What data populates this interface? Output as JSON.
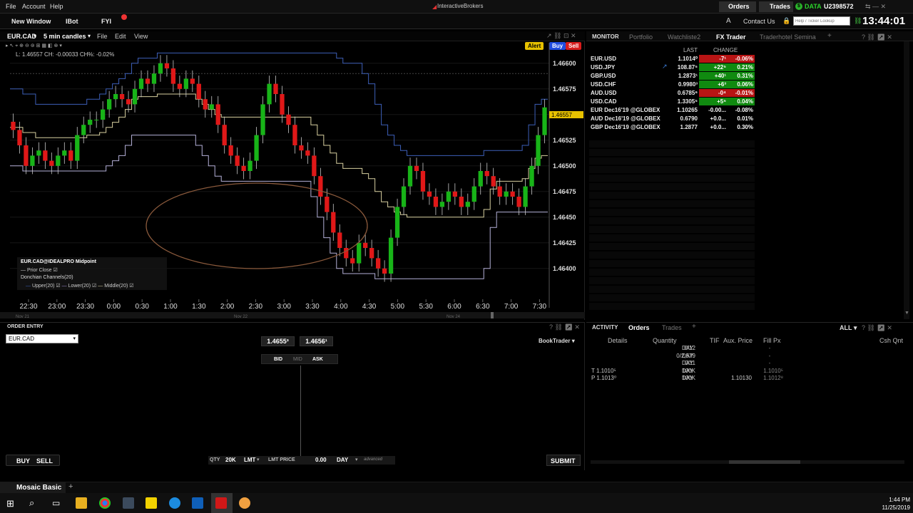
{
  "menubar": {
    "items": [
      "File",
      "Account",
      "Help"
    ],
    "brand": "InteractiveBrokers",
    "orders": "Orders",
    "trades": "Trades",
    "data_label": "DATA",
    "account_id": "U2398572"
  },
  "toolbar": {
    "buttons": [
      "New Window",
      "IBot",
      "FYI"
    ],
    "contact_us": "Contact Us",
    "search_placeholder": "Help / Ticker Lookup",
    "clock": "13:44:01"
  },
  "chart": {
    "symbol": "EUR.CAD",
    "timeframe": "5 min candles",
    "menu": [
      "File",
      "Edit",
      "View"
    ],
    "ohlc_line": "L: 1.46557 CH: -0.00033 CH%: -0.02%",
    "alert": "Alert",
    "buy": "Buy",
    "sell": "Sell",
    "current_price": "1.46557",
    "legend": {
      "title": "EUR.CAD@IDEALPRO Midpoint",
      "prior_close": "Prior Close",
      "donchian": "Donchian Channels(20)",
      "upper": "Upper(20)",
      "lower": "Lower(20)",
      "middle": "Middle(20)"
    },
    "date_labels": [
      "Nov 21",
      "Nov 22",
      "Nov 24"
    ],
    "colors": {
      "up": "#18b418",
      "down": "#e01818",
      "upper": "#3d5fb8",
      "middle": "#d8d0a0",
      "annotation": "#8b5a3c"
    }
  },
  "chart_data": {
    "type": "candlestick",
    "y_ticks": [
      "1.46600",
      "1.46575",
      "1.46550",
      "1.46525",
      "1.46500",
      "1.46475",
      "1.46450",
      "1.46425",
      "1.46400"
    ],
    "x_ticks": [
      "22:30",
      "23:00",
      "23:30",
      "0:00",
      "0:30",
      "1:00",
      "1:30",
      "2:00",
      "2:30",
      "3:00",
      "3:30",
      "4:00",
      "4:30",
      "5:00",
      "5:30",
      "6:00",
      "6:30",
      "7:00",
      "7:30"
    ],
    "ylim": [
      1.4637,
      1.4662
    ],
    "close": [
      1.46535,
      1.4652,
      1.465,
      1.4651,
      1.46515,
      1.46505,
      1.465,
      1.4651,
      1.46515,
      1.46505,
      1.4653,
      1.4654,
      1.46545,
      1.46545,
      1.46555,
      1.46565,
      1.4657,
      1.46565,
      1.4656,
      1.46575,
      1.46585,
      1.4658,
      1.4659,
      1.466,
      1.46595,
      1.4658,
      1.46575,
      1.46585,
      1.4658,
      1.46565,
      1.46555,
      1.4656,
      1.4654,
      1.4652,
      1.4651,
      1.465,
      1.46495,
      1.46505,
      1.4653,
      1.4656,
      1.4658,
      1.4657,
      1.4655,
      1.4654,
      1.4652,
      1.46515,
      1.4651,
      1.4649,
      1.4647,
      1.46455,
      1.46435,
      1.4642,
      1.4641,
      1.46405,
      1.46425,
      1.4642,
      1.4641,
      1.464,
      1.46395,
      1.4643,
      1.4646,
      1.4648,
      1.465,
      1.46495,
      1.46475,
      1.4647,
      1.4646,
      1.46465,
      1.46475,
      1.4647,
      1.4646,
      1.46465,
      1.4648,
      1.46495,
      1.4649,
      1.4648,
      1.4647,
      1.46475,
      1.4647,
      1.4646,
      1.4648,
      1.465,
      1.4653,
      1.46557
    ],
    "upper": [
      1.46575,
      1.46575,
      1.4657,
      1.4657,
      1.4656,
      1.4656,
      1.4656,
      1.4656,
      1.4656,
      1.4656,
      1.4656,
      1.4656,
      1.46565,
      1.46565,
      1.4657,
      1.46575,
      1.4658,
      1.46585,
      1.4659,
      1.466,
      1.46605,
      1.46605,
      1.46605,
      1.4661,
      1.4661,
      1.4661,
      1.4661,
      1.4661,
      1.4661,
      1.4661,
      1.4661,
      1.4661,
      1.4661,
      1.4661,
      1.4661,
      1.4661,
      1.4661,
      1.4661,
      1.4661,
      1.4661,
      1.4661,
      1.4661,
      1.4661,
      1.4661,
      1.4661,
      1.4661,
      1.4661,
      1.4661,
      1.4661,
      1.4661,
      1.4661,
      1.46605,
      1.466,
      1.466,
      1.466,
      1.4659,
      1.4658,
      1.4656,
      1.4654,
      1.4653,
      1.4652,
      1.46515,
      1.4651,
      1.4651,
      1.4651,
      1.4651,
      1.4651,
      1.4651,
      1.4651,
      1.4651,
      1.4651,
      1.4651,
      1.4651,
      1.4651,
      1.46515,
      1.46515,
      1.46515,
      1.46515,
      1.46515,
      1.46515,
      1.4652,
      1.4654,
      1.4656,
      1.46565
    ],
    "lower": [
      1.465,
      1.465,
      1.46495,
      1.46495,
      1.46495,
      1.46495,
      1.46495,
      1.46495,
      1.46495,
      1.46495,
      1.46495,
      1.46495,
      1.46495,
      1.46495,
      1.46495,
      1.465,
      1.46505,
      1.4651,
      1.4652,
      1.4653,
      1.4653,
      1.4653,
      1.4653,
      1.4653,
      1.4653,
      1.4653,
      1.4653,
      1.4653,
      1.4653,
      1.4652,
      1.4651,
      1.465,
      1.4649,
      1.46485,
      1.46485,
      1.46485,
      1.46485,
      1.46485,
      1.46485,
      1.46485,
      1.46485,
      1.46485,
      1.46485,
      1.46485,
      1.46485,
      1.46485,
      1.46485,
      1.4647,
      1.4645,
      1.4643,
      1.46415,
      1.464,
      1.46395,
      1.46395,
      1.46395,
      1.46395,
      1.46395,
      1.4639,
      1.4639,
      1.4639,
      1.4639,
      1.4639,
      1.4639,
      1.4639,
      1.4639,
      1.4639,
      1.4639,
      1.4639,
      1.4639,
      1.4639,
      1.4639,
      1.4639,
      1.4639,
      1.4639,
      1.464,
      1.4644,
      1.46455,
      1.46455,
      1.46455,
      1.46455,
      1.46455,
      1.46455,
      1.46455,
      1.46455
    ]
  },
  "monitor": {
    "tabs": [
      "MONITOR",
      "Portfolio",
      "Watchliste2",
      "FX Trader",
      "Traderhotel Semina"
    ],
    "headers": {
      "last": "LAST",
      "change": "CHANGE"
    },
    "rows": [
      {
        "sym": "EUR.USD",
        "last": "1.1014⁰",
        "chg": "-7¹",
        "pct": "-0.06%",
        "dir": "down"
      },
      {
        "sym": "USD.JPY",
        "last": "108.87⁵",
        "chg": "+22⁵",
        "pct": "0.21%",
        "dir": "up"
      },
      {
        "sym": "GBP.USD",
        "last": "1.2873¹",
        "chg": "+40¹",
        "pct": "0.31%",
        "dir": "up"
      },
      {
        "sym": "USD.CHF",
        "last": "0.9980³",
        "chg": "+6³",
        "pct": "0.06%",
        "dir": "up"
      },
      {
        "sym": "AUD.USD",
        "last": "0.6785⁶",
        "chg": "-0⁴",
        "pct": "-0.01%",
        "dir": "down"
      },
      {
        "sym": "USD.CAD",
        "last": "1.3305⁵",
        "chg": "+5⁵",
        "pct": "0.04%",
        "dir": "up"
      },
      {
        "sym": "EUR Dec16'19 @GLOBEX",
        "last": "1.10265",
        "chg": "-0.00...",
        "pct": "-0.08%",
        "dir": "none"
      },
      {
        "sym": "AUD Dec16'19 @GLOBEX",
        "last": "0.6790",
        "chg": "+0.0...",
        "pct": "0.01%",
        "dir": "none"
      },
      {
        "sym": "GBP Dec16'19 @GLOBEX",
        "last": "1.2877",
        "chg": "+0.0...",
        "pct": "0.30%",
        "dir": "none"
      }
    ]
  },
  "order_entry": {
    "title": "ORDER ENTRY",
    "symbol": "EUR.CAD",
    "bid": "1.4655³",
    "ask": "1.4656¹",
    "bid_label": "BID",
    "mid_label": "MID",
    "ask_label": "ASK",
    "booktrader": "BookTrader",
    "buy": "BUY",
    "sell": "SELL",
    "qty_label": "QTY",
    "qty": "20K",
    "order_type": "LMT",
    "lmt_price_label": "LMT PRICE",
    "lmt_price": "0.00",
    "tif": "DAY",
    "advanced": "advanced",
    "submit": "SUBMIT"
  },
  "activity": {
    "tabs": [
      "ACTIVITY",
      "Orders",
      "Trades"
    ],
    "filter": "ALL",
    "columns": [
      "Details",
      "Quantity",
      "TIF",
      "Aux. Price",
      "Fill Px",
      "Csh Qnt"
    ],
    "rows": [
      {
        "details": "",
        "qty": "0/12",
        "tif": "DAY",
        "aux": "",
        "fill": "-"
      },
      {
        "details": "",
        "qty": "0/2,579",
        "tif": "DAY",
        "aux": "",
        "fill": "-"
      },
      {
        "details": "",
        "qty": "0/11",
        "tif": "DAY",
        "aux": "",
        "fill": "-"
      },
      {
        "details": "T 1.1010⁵",
        "qty": "100K",
        "tif": "DAY",
        "aux": "",
        "fill": "1.1010⁵"
      },
      {
        "details": "P 1.1013⁰",
        "qty": "100K",
        "tif": "DAY",
        "aux": "1.10130",
        "fill": "1.1012⁸"
      }
    ]
  },
  "mosaic": {
    "label": "Mosaic Basic",
    "add": "+"
  },
  "taskbar": {
    "time": "1:44 PM",
    "date": "11/25/2019"
  }
}
